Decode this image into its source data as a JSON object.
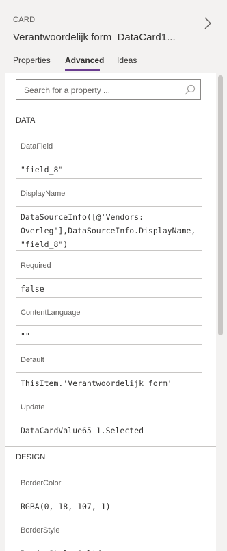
{
  "header": {
    "kind": "CARD",
    "title": "Verantwoordelijk form_DataCard1..."
  },
  "tabs": [
    {
      "label": "Properties"
    },
    {
      "label": "Advanced"
    },
    {
      "label": "Ideas"
    }
  ],
  "active_tab": "Advanced",
  "search": {
    "placeholder": "Search for a property ..."
  },
  "data_section": {
    "title": "DATA",
    "fields": [
      {
        "label": "DataField",
        "value": "\"field_8\""
      },
      {
        "label": "DisplayName",
        "value": "DataSourceInfo([@'Vendors:\nOverleg'],DataSourceInfo.DisplayName,\n\"field_8\")"
      },
      {
        "label": "Required",
        "value": "false"
      },
      {
        "label": "ContentLanguage",
        "value": "\"\""
      },
      {
        "label": "Default",
        "value": "ThisItem.'Verantwoordelijk form'"
      },
      {
        "label": "Update",
        "value": "DataCardValue65_1.Selected"
      }
    ]
  },
  "design_section": {
    "title": "DESIGN",
    "fields": [
      {
        "label": "BorderColor",
        "value": "RGBA(0, 18, 107, 1)"
      },
      {
        "label": "BorderStyle",
        "value": "BorderStyle.Solid"
      }
    ]
  },
  "colors": {
    "accent": "#6a3d8f",
    "panel": "#ffffff",
    "background": "#f3f2f1"
  },
  "icons": {
    "chevron": "chevron-right-icon",
    "search": "search-icon"
  }
}
